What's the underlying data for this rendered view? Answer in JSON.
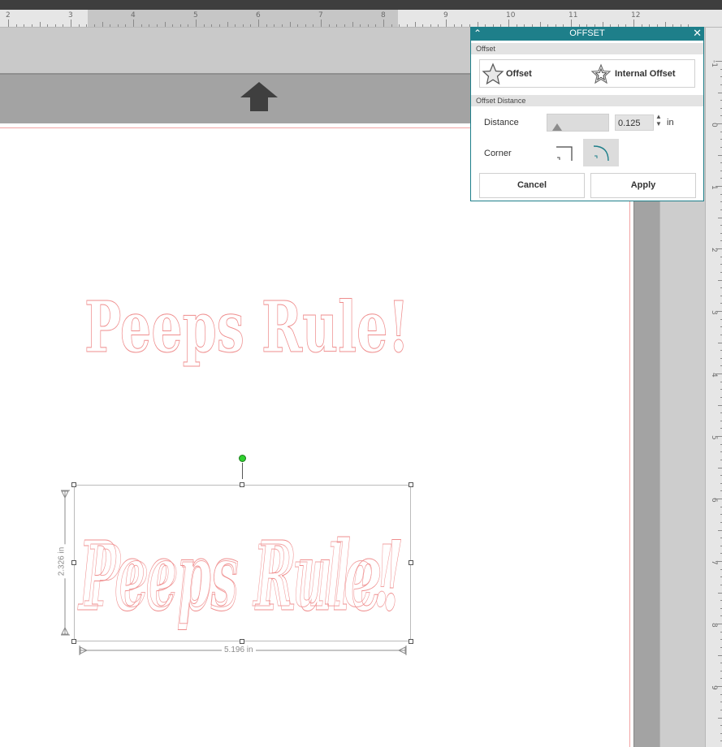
{
  "ruler": {
    "top_labels": [
      "2",
      "3",
      "4",
      "5",
      "6",
      "7",
      "8",
      "9",
      "10",
      "11",
      "12"
    ],
    "side_labels": [
      "-1",
      "0",
      "1",
      "2",
      "3",
      "4",
      "5",
      "6",
      "7",
      "8",
      "9"
    ]
  },
  "canvas": {
    "design_top_text": "Peeps Rule!",
    "design_bottom_text": "Peeps Rule!",
    "selection": {
      "height_label": "2.326 in",
      "width_label": "5.196 in"
    }
  },
  "dialog": {
    "title": "OFFSET",
    "section_offset": "Offset",
    "option_offset": "Offset",
    "option_internal": "Internal Offset",
    "section_distance": "Offset Distance",
    "distance_label": "Distance",
    "distance_value": "0.125",
    "distance_unit": "in",
    "corner_label": "Corner",
    "corner_selected": "rounded",
    "cancel_label": "Cancel",
    "apply_label": "Apply"
  },
  "colors": {
    "dialog_accent": "#1e7f8a",
    "cut_line": "#ef8d8d",
    "rotate_handle": "#2fd12f"
  },
  "icons": {
    "collapse": "chevron-up-icon",
    "close": "close-icon",
    "offset": "star-outline-icon",
    "internal": "star-internal-icon",
    "move_up": "arrow-up-icon"
  }
}
